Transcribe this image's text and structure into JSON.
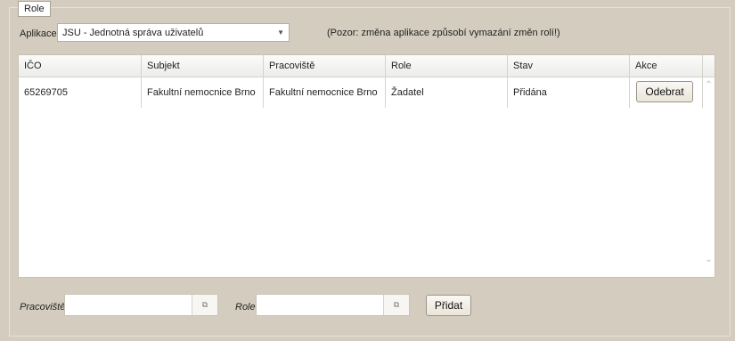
{
  "fieldset": {
    "legend": "Role"
  },
  "application": {
    "label": "Aplikace",
    "selected": "JSU - Jednotná správa uživatelů",
    "arrow_icon": "triangle-down",
    "warning": "(Pozor: změna aplikace způsobí vymazání změn rolí!)"
  },
  "grid": {
    "columns": [
      "IČO",
      "Subjekt",
      "Pracoviště",
      "Role",
      "Stav",
      "Akce"
    ],
    "rows": [
      {
        "ico": "65269705",
        "subjekt": "Fakultní nemocnice Brno",
        "pracoviste": "Fakultní nemocnice Brno",
        "role": "Žadatel",
        "stav": "Přidána",
        "action": "Odebrat"
      }
    ]
  },
  "bottom": {
    "pracoviste_label": "Pracoviště",
    "role_label": "Role",
    "pracoviste_value": "",
    "role_value": "",
    "trigger_icon": "popup-window-icon",
    "add_button": "Přidat"
  }
}
